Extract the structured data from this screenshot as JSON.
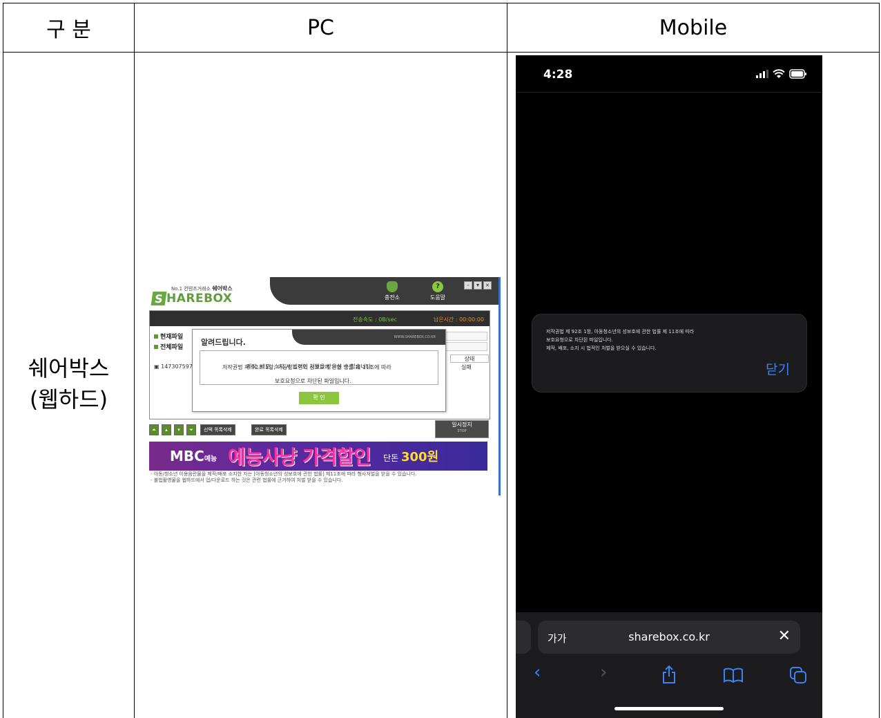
{
  "table": {
    "header": {
      "category": "구 분",
      "pc": "PC",
      "mobile": "Mobile"
    },
    "row_label_line1": "쉐어박스",
    "row_label_line2": "(웹하드)"
  },
  "pc": {
    "slogan_small": "No.1 컨텐츠거래소",
    "slogan_name": "쉐어박스",
    "logo_s": "S",
    "logo_text": "HAREBOX",
    "top_icons": [
      "충전소",
      "도움말"
    ],
    "window_buttons": [
      "–",
      "▾",
      "×"
    ],
    "speed": "전송속도 : 0B/sec",
    "remaining": "남은시간 : 00:00:00",
    "current_file": "현재파일",
    "all_files": "전체파일",
    "file_name": "147307597",
    "col_status": "상태",
    "status_value": "실패",
    "dialog": {
      "title": "알려드립니다.",
      "url": "WWW.SHAREBOX.CO.KR",
      "line1": "저작권법 제 92조 1항, 아동청소년의 성보호에 관한 법률 제 11조에 따라",
      "line2": "보호요청으로 차단된 파일입니다.",
      "line3": "제작, 배포, 소지 시 법적인 처벌을 받으실 수 있습니다.",
      "ok": "확 인"
    },
    "controls": {
      "delete_selected": "선택 목록삭제",
      "delete_done": "완료 목록삭제"
    },
    "pause": "일시정지",
    "pause_sub": "STOP",
    "banner": {
      "mbc": "MBC",
      "mbc_sub": "예능",
      "headline": "예능사냥 가격할인",
      "price_prefix": "단돈",
      "price": "300원"
    },
    "notice_line1": "- 아동/청소년 이용음란물을 제작/배포 소지한 자는 [아동청소년의 성보호에 관한 법률] 제11조에 따라 형사처벌을 받을 수 있습니다.",
    "notice_line2": "- 불법촬영물을 웹하드에서 업/다운로드 하는 것은 관련 법률에 근거하여 처벌 받을 수 있습니다."
  },
  "mobile": {
    "time": "4:28",
    "alert_line1": "저작권법 제 92조 1항, 아동청소년의 성보호에 관한 법률 제 11조에 따라",
    "alert_line2": "보호요청으로 차단된 파일입니다.",
    "alert_line3": "제작, 배포, 소지 시 법적인 처벌을 받으실 수 있습니다.",
    "close": "닫기",
    "aa": "가가",
    "url": "sharebox.co.kr",
    "clear": "✕",
    "toolbar": {
      "back": "‹",
      "forward": "›",
      "share": "⇪",
      "bookmarks": "📖",
      "tabs": "⧉"
    }
  },
  "colors": {
    "accent_green": "#6aa642",
    "ios_blue": "#3b82f6",
    "banner_pink": "#ff2f9f"
  }
}
